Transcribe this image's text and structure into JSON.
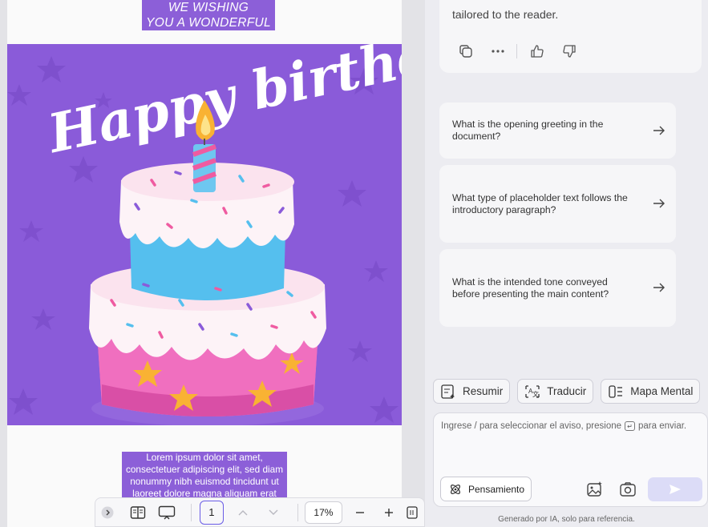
{
  "document": {
    "heading_line1": "WE WISHING",
    "heading_line2": "YOU A WONDERFUL",
    "banner_text": "Happy birthday",
    "lorem": "Lorem ipsum dolor sit amet, consectetuer adipiscing elit, sed diam nonummy nibh euismod tincidunt ut laoreet dolore magna aliquam erat"
  },
  "toolbar": {
    "page_number": "1",
    "zoom": "17%",
    "icons": [
      "chevron-right-icon",
      "reader-view-icon",
      "presentation-icon",
      "page-up-icon",
      "page-down-icon",
      "zoom-out-icon",
      "zoom-in-icon",
      "fit-page-icon"
    ]
  },
  "assistant": {
    "answer_tail": "tailored to the reader.",
    "answer_actions": [
      "copy-icon",
      "more-icon",
      "thumbs-up-icon",
      "thumbs-down-icon"
    ],
    "suggestions": [
      {
        "text": "What is the opening greeting in the document?"
      },
      {
        "text": "What type of placeholder text follows the introductory paragraph?"
      },
      {
        "text": "What is the intended tone conveyed before presenting the main content?"
      }
    ],
    "chips": [
      {
        "label": "Resumir",
        "icon": "summary-icon"
      },
      {
        "label": "Traducir",
        "icon": "translate-icon"
      },
      {
        "label": "Mapa Mental",
        "icon": "mind-map-icon"
      }
    ],
    "input_placeholder_before": "Ingrese / para seleccionar el aviso, presione",
    "input_placeholder_after": "para enviar.",
    "thinking_label": "Pensamiento",
    "footer_note": "Generado por IA, solo para referencia.",
    "colors": {
      "accent": "#6a5ce6",
      "send_disabled": "#dcdcf7",
      "banner_purple": "#8a5bd9"
    }
  }
}
